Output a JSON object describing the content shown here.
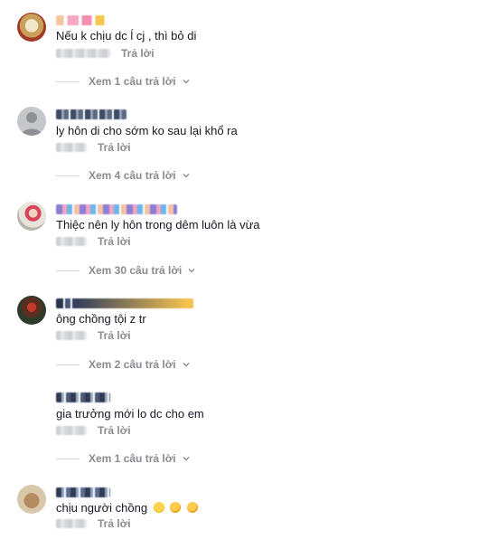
{
  "comments": [
    {
      "text": "Nếu k chịu dc ĺ cj , thì bỏ di",
      "reply_label": "Trả lời",
      "view_replies": "Xem 1 câu trả lời"
    },
    {
      "text": "ly hôn di cho sớm ko sau lại khổ ra",
      "reply_label": "Trả lời",
      "view_replies": "Xem 4 câu trả lời"
    },
    {
      "text": "Thiệc nên ly hôn trong dêm luôn là vừa",
      "reply_label": "Trả lời",
      "view_replies": "Xem 30 câu trả lời"
    },
    {
      "text": "ông chồng tội z tr",
      "reply_label": "Trả lời",
      "view_replies": "Xem 2 câu trả lời"
    },
    {
      "text": "gia trưởng mới lo dc cho em",
      "reply_label": "Trả lời",
      "view_replies": "Xem 1 câu trả lời"
    },
    {
      "text": "chịu người chồng",
      "reply_label": "Trả lời",
      "emojis": [
        "😑",
        "🤣",
        "🤣"
      ]
    }
  ],
  "colors": {
    "text": "#161823",
    "muted": "#8a8b91",
    "divider": "#d5d6d9"
  },
  "icons": {
    "chevron": "chevron-down-icon",
    "default_avatar": "user-silhouette-icon"
  }
}
